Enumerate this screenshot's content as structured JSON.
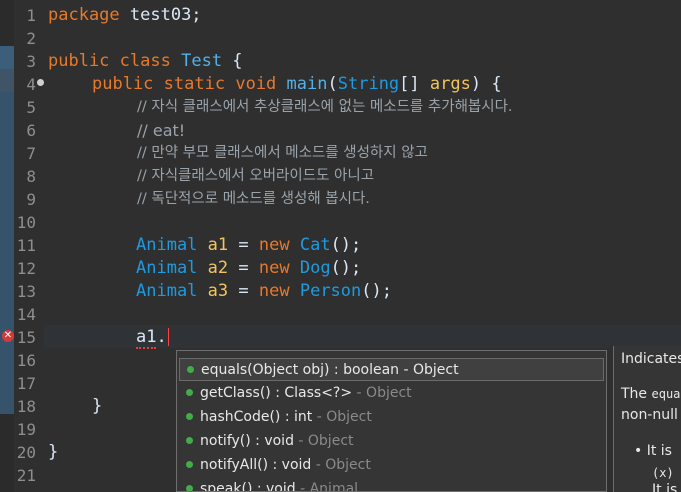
{
  "editor": {
    "line_numbers": [
      "1",
      "2",
      "3",
      "4",
      "5",
      "6",
      "7",
      "8",
      "9",
      "10",
      "11",
      "12",
      "13",
      "14",
      "15",
      "16",
      "17",
      "18",
      "19",
      "20",
      "21"
    ],
    "code": {
      "l1_kw": "package",
      "l1_rest": " test03;",
      "l3_kw1": "public",
      "l3_kw2": "class",
      "l3_name": "Test",
      "l3_rest": " {",
      "l4_kw1": "public",
      "l4_kw2": "static",
      "l4_kw3": "void",
      "l4_name": "main",
      "l4_open": "(",
      "l4_type": "String",
      "l4_arr": "[] ",
      "l4_arg": "args",
      "l4_close": ") {",
      "c5": "// 자식 클래스에서 추상클래스에 없는 메소드를 추가해봅시다.",
      "c6": "// eat!",
      "c7": "// 만약 부모 클래스에서 메소드를 생성하지 않고",
      "c8": "// 자식클래스에서 오버라이드도 아니고",
      "c9": "// 독단적으로 메소드를 생성해 봅시다.",
      "l11_type": "Animal",
      "l11_var": "a1",
      "l11_eq": " = ",
      "l11_new": "new",
      "l11_cls": "Cat",
      "l11_end": "();",
      "l12_type": "Animal",
      "l12_var": "a2",
      "l12_eq": " = ",
      "l12_new": "new",
      "l12_cls": "Dog",
      "l12_end": "();",
      "l13_type": "Animal",
      "l13_var": "a3",
      "l13_eq": " = ",
      "l13_new": "new",
      "l13_cls": "Person",
      "l13_end": "();",
      "l15_var": "a1",
      "l15_dot": ".",
      "l18": "}",
      "l20": "}"
    }
  },
  "completion": {
    "items": [
      {
        "sig": "equals(Object obj) : boolean",
        "owner": " - Object"
      },
      {
        "sig": "getClass() : Class<?>",
        "owner": " - Object"
      },
      {
        "sig": "hashCode() : int",
        "owner": " - Object"
      },
      {
        "sig": "notify() : void",
        "owner": " - Object"
      },
      {
        "sig": "notifyAll() : void",
        "owner": " - Object"
      },
      {
        "sig": "speak() : void",
        "owner": " - Animal"
      }
    ]
  },
  "doc": {
    "line1": "Indicates",
    "line2a": "The ",
    "line2b": "equal",
    "line3": "non-null",
    "line4": "• It is",
    "line5": "(x)",
    "line6": "It is"
  },
  "colors": {
    "keyword": "#e8792b",
    "type": "#1e9ae0",
    "variable": "#f2c55c",
    "comment": "#9aa3ab"
  }
}
